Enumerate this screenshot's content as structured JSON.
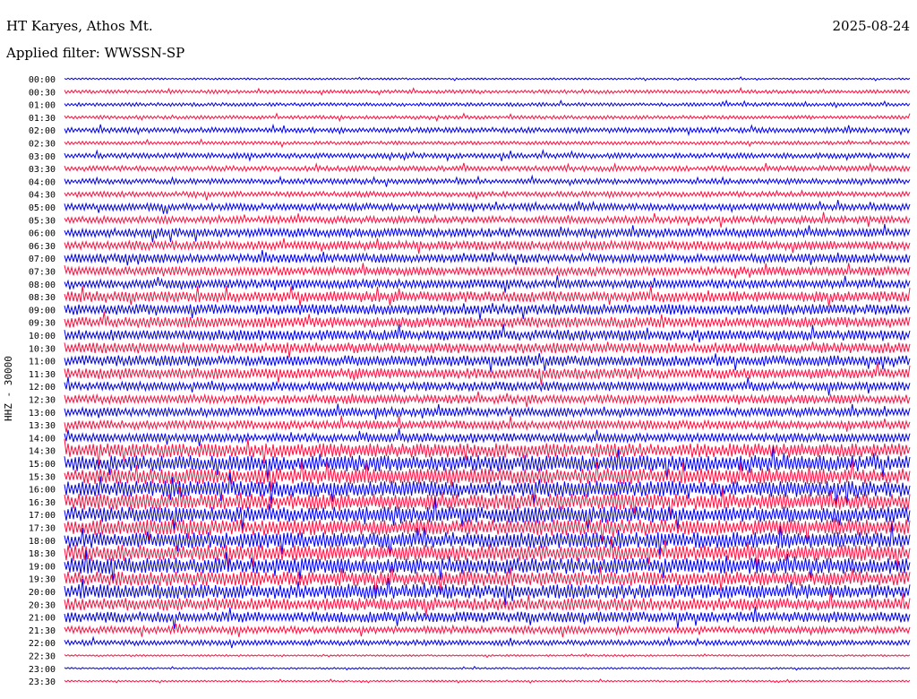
{
  "header": {
    "station": "HT Karyes, Athos Mt.",
    "date": "2025-08-24",
    "filter": "Applied filter: WWSSN-SP"
  },
  "chart_data": {
    "type": "line",
    "title": "HT Karyes, Athos Mt.",
    "ylabel": "HHZ - 30000",
    "xlabel": "",
    "series_colors": [
      "#0000ee",
      "#ff1040"
    ],
    "rows": [
      {
        "label": "00:00",
        "amp": 1,
        "color": "#0000ee"
      },
      {
        "label": "00:30",
        "amp": 2,
        "color": "#ff1040"
      },
      {
        "label": "01:00",
        "amp": 2,
        "color": "#0000ee"
      },
      {
        "label": "01:30",
        "amp": 2,
        "color": "#ff1040"
      },
      {
        "label": "02:00",
        "amp": 3,
        "color": "#0000ee"
      },
      {
        "label": "02:30",
        "amp": 2,
        "color": "#ff1040"
      },
      {
        "label": "03:00",
        "amp": 3,
        "color": "#0000ee"
      },
      {
        "label": "03:30",
        "amp": 3,
        "color": "#ff1040"
      },
      {
        "label": "04:00",
        "amp": 3,
        "color": "#0000ee"
      },
      {
        "label": "04:30",
        "amp": 3,
        "color": "#ff1040"
      },
      {
        "label": "05:00",
        "amp": 4,
        "color": "#0000ee"
      },
      {
        "label": "05:30",
        "amp": 4,
        "color": "#ff1040"
      },
      {
        "label": "06:00",
        "amp": 5,
        "color": "#0000ee"
      },
      {
        "label": "06:30",
        "amp": 5,
        "color": "#ff1040"
      },
      {
        "label": "07:00",
        "amp": 5,
        "color": "#0000ee"
      },
      {
        "label": "07:30",
        "amp": 5,
        "color": "#ff1040"
      },
      {
        "label": "08:00",
        "amp": 5,
        "color": "#0000ee"
      },
      {
        "label": "08:30",
        "amp": 6,
        "color": "#ff1040"
      },
      {
        "label": "09:00",
        "amp": 6,
        "color": "#0000ee"
      },
      {
        "label": "09:30",
        "amp": 6,
        "color": "#ff1040"
      },
      {
        "label": "10:00",
        "amp": 6,
        "color": "#0000ee"
      },
      {
        "label": "10:30",
        "amp": 6,
        "color": "#ff1040"
      },
      {
        "label": "11:00",
        "amp": 6,
        "color": "#0000ee"
      },
      {
        "label": "11:30",
        "amp": 6,
        "color": "#ff1040"
      },
      {
        "label": "12:00",
        "amp": 5,
        "color": "#0000ee"
      },
      {
        "label": "12:30",
        "amp": 5,
        "color": "#ff1040"
      },
      {
        "label": "13:00",
        "amp": 5,
        "color": "#0000ee"
      },
      {
        "label": "13:30",
        "amp": 5,
        "color": "#ff1040"
      },
      {
        "label": "14:00",
        "amp": 5,
        "color": "#0000ee"
      },
      {
        "label": "14:30",
        "amp": 8,
        "color": "#ff1040"
      },
      {
        "label": "15:00",
        "amp": 9,
        "color": "#0000ee"
      },
      {
        "label": "15:30",
        "amp": 9,
        "color": "#ff1040"
      },
      {
        "label": "16:00",
        "amp": 9,
        "color": "#0000ee"
      },
      {
        "label": "16:30",
        "amp": 9,
        "color": "#ff1040"
      },
      {
        "label": "17:00",
        "amp": 9,
        "color": "#0000ee"
      },
      {
        "label": "17:30",
        "amp": 9,
        "color": "#ff1040"
      },
      {
        "label": "18:00",
        "amp": 9,
        "color": "#0000ee"
      },
      {
        "label": "18:30",
        "amp": 9,
        "color": "#ff1040"
      },
      {
        "label": "19:00",
        "amp": 9,
        "color": "#0000ee"
      },
      {
        "label": "19:30",
        "amp": 8,
        "color": "#ff1040"
      },
      {
        "label": "20:00",
        "amp": 8,
        "color": "#0000ee"
      },
      {
        "label": "20:30",
        "amp": 7,
        "color": "#ff1040"
      },
      {
        "label": "21:00",
        "amp": 6,
        "color": "#0000ee"
      },
      {
        "label": "21:30",
        "amp": 4,
        "color": "#ff1040"
      },
      {
        "label": "22:00",
        "amp": 3,
        "color": "#0000ee"
      },
      {
        "label": "22:30",
        "amp": 1,
        "color": "#ff1040"
      },
      {
        "label": "23:00",
        "amp": 1,
        "color": "#0000ee"
      },
      {
        "label": "23:30",
        "amp": 1,
        "color": "#ff1040"
      }
    ]
  }
}
